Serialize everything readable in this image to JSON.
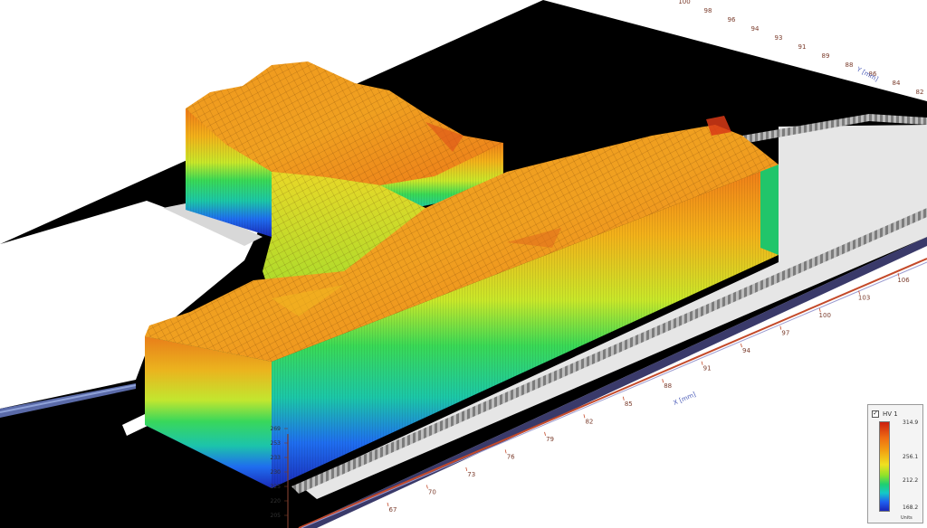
{
  "chart_data": {
    "type": "surface",
    "x_axis": {
      "label": "X [mm]",
      "ticks": [
        67,
        70,
        73,
        76,
        79,
        82,
        85,
        88,
        91,
        94,
        97,
        100,
        103,
        106
      ]
    },
    "y_axis": {
      "label": "Y [mm]",
      "ticks": [
        100,
        98,
        96,
        94,
        93,
        91,
        89,
        88,
        86,
        84,
        82
      ]
    },
    "z_axis": {
      "ticks": [
        205,
        220,
        225,
        230,
        233,
        253,
        269
      ]
    },
    "legend": {
      "title": "HV 1",
      "checked": true,
      "max": "314.9",
      "mid_high": "256.1",
      "mid_low": "212.2",
      "min": "168.2",
      "units": "Units"
    },
    "colorscale": [
      "#1a26b8",
      "#1f5ff0",
      "#14c8c8",
      "#1fd070",
      "#8fe22a",
      "#f0e020",
      "#f2a012",
      "#ef6d12",
      "#cc1f10"
    ]
  }
}
